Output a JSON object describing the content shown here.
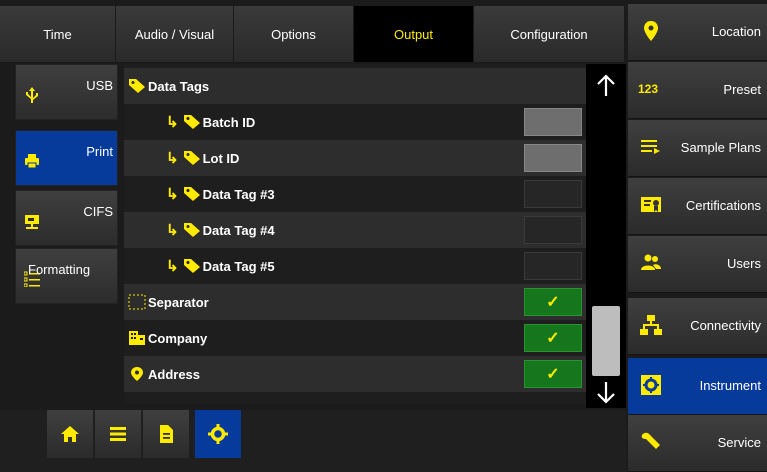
{
  "tabs": [
    {
      "label": "Time"
    },
    {
      "label": "Audio / Visual"
    },
    {
      "label": "Options"
    },
    {
      "label": "Output"
    },
    {
      "label": "Configuration"
    }
  ],
  "subnav": [
    {
      "label": "USB",
      "icon": "usb-icon"
    },
    {
      "label": "Print",
      "icon": "printer-icon"
    },
    {
      "label": "CIFS",
      "icon": "network-drive-icon"
    },
    {
      "label": "Formatting",
      "icon": "formatting-list-icon"
    }
  ],
  "list": {
    "header": "Data Tags",
    "rows": [
      {
        "label": "Batch ID",
        "state": "unchecked-grey"
      },
      {
        "label": "Lot ID",
        "state": "unchecked-grey"
      },
      {
        "label": "Data Tag #3",
        "state": "unchecked"
      },
      {
        "label": "Data Tag #4",
        "state": "unchecked"
      },
      {
        "label": "Data Tag #5",
        "state": "unchecked"
      },
      {
        "label": "Separator",
        "state": "checked"
      },
      {
        "label": "Company",
        "state": "checked"
      },
      {
        "label": "Address",
        "state": "checked"
      }
    ]
  },
  "rightnav": [
    {
      "label": "Location",
      "icon": "location-pin-icon"
    },
    {
      "label": "Preset",
      "icon": "preset-123-icon"
    },
    {
      "label": "Sample Plans",
      "icon": "sample-plans-icon"
    },
    {
      "label": "Certifications",
      "icon": "certificate-icon"
    },
    {
      "label": "Users",
      "icon": "users-icon"
    },
    {
      "label": "Connectivity",
      "icon": "network-icon"
    },
    {
      "label": "Instrument",
      "icon": "instrument-gear-icon"
    },
    {
      "label": "Service",
      "icon": "wrench-icon"
    }
  ],
  "icons_text": {
    "preset": "123",
    "check": "✓"
  },
  "colors": {
    "accent": "#ffeb00",
    "active_blue": "#063a9b",
    "checked_green": "#16761d"
  }
}
